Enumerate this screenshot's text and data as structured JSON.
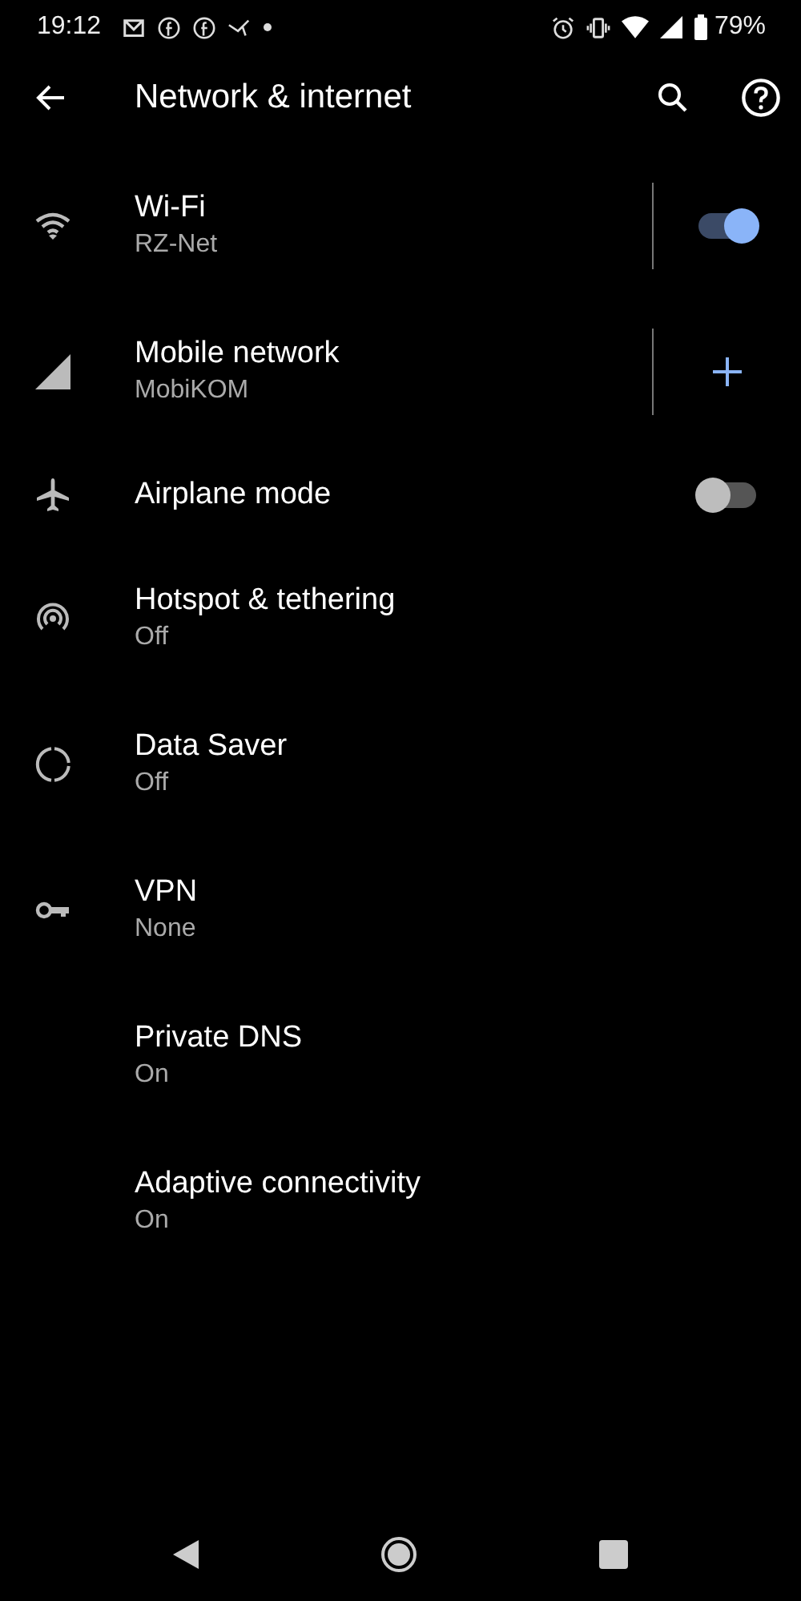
{
  "status_bar": {
    "time": "19:12",
    "battery": "79%"
  },
  "toolbar": {
    "title": "Network & internet"
  },
  "items": [
    {
      "title": "Wi-Fi",
      "summary": "RZ-Net",
      "kind": "toggle",
      "on": true,
      "divider": true
    },
    {
      "title": "Mobile network",
      "summary": "MobiKOM",
      "kind": "add",
      "divider": true
    },
    {
      "title": "Airplane mode",
      "kind": "toggle",
      "on": false,
      "divider": false
    },
    {
      "title": "Hotspot & tethering",
      "summary": "Off",
      "kind": "plain",
      "divider": false
    },
    {
      "title": "Data Saver",
      "summary": "Off",
      "kind": "plain",
      "divider": false
    },
    {
      "title": "VPN",
      "summary": "None",
      "kind": "plain",
      "divider": false
    },
    {
      "title": "Private DNS",
      "summary": "On",
      "kind": "plain",
      "divider": false
    },
    {
      "title": "Adaptive connectivity",
      "summary": "On",
      "kind": "plain",
      "divider": false
    }
  ]
}
